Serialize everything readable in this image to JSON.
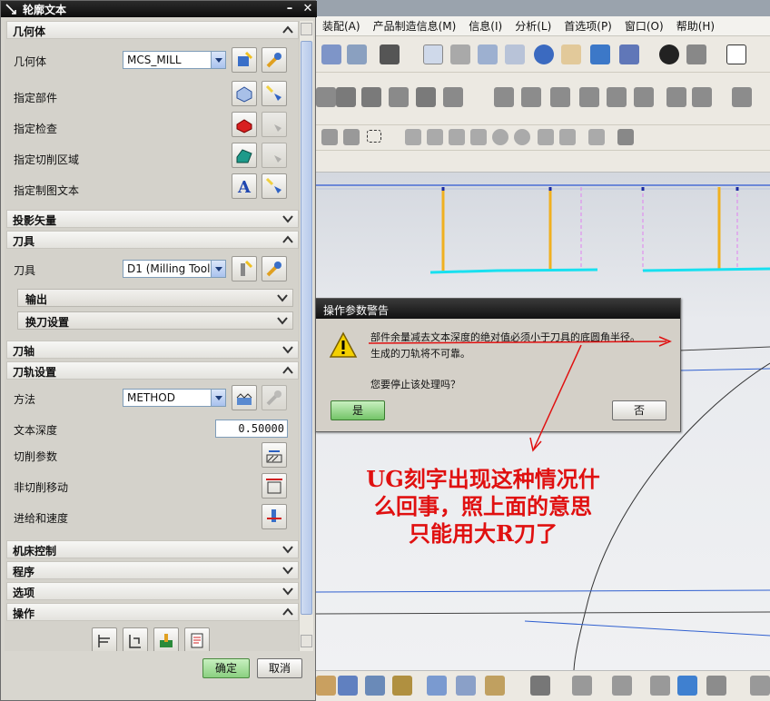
{
  "dialog": {
    "title": "轮廓文本",
    "sections": {
      "geometry": "几何体",
      "projection": "投影矢量",
      "tool": "刀具",
      "axis": "刀轴",
      "path": "刀轨设置",
      "machine": "机床控制",
      "program": "程序",
      "options": "选项",
      "actions": "操作"
    },
    "geometry_rows": {
      "geometry_label": "几何体",
      "geometry_value": "MCS_MILL",
      "part": "指定部件",
      "check": "指定检查",
      "cut_area": "指定切削区域",
      "drafting_text": "指定制图文本"
    },
    "tool_rows": {
      "tool_label": "刀具",
      "tool_value": "D1 (Milling Tool",
      "output": "输出",
      "tool_change": "换刀设置"
    },
    "path_rows": {
      "method_label": "方法",
      "method_value": "METHOD",
      "text_depth_label": "文本深度",
      "text_depth_value": "0.50000",
      "cut_params": "切削参数",
      "non_cut_moves": "非切削移动",
      "feeds_speeds": "进给和速度"
    },
    "ok": "确定",
    "cancel": "取消"
  },
  "menubar": [
    "装配(A)",
    "产品制造信息(M)",
    "信息(I)",
    "分析(L)",
    "首选项(P)",
    "窗口(O)",
    "帮助(H)"
  ],
  "warning": {
    "title": "操作参数警告",
    "line1": "部件余量减去文本深度的绝对值必须小于刀具的底圆角半径。",
    "line2": "生成的刀轨将不可靠。",
    "question": "您要停止该处理吗？",
    "yes": "是",
    "no": "否"
  },
  "annotation": {
    "line1": "UG刻字出现这种情况什",
    "line2": "么回事，照上面的意思",
    "line3": "只能用大R刀了"
  },
  "colors": {
    "annotation": "#e01010",
    "tool_stroke": "#f0b020",
    "path_cyan": "#18e0f0"
  }
}
